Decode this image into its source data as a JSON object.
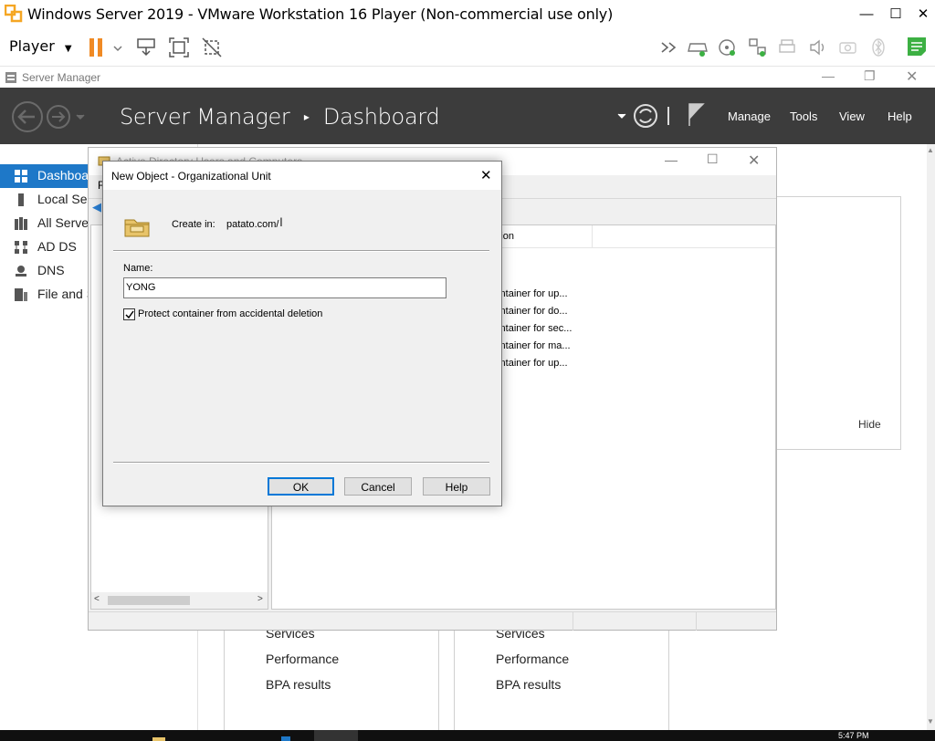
{
  "vmware": {
    "title": "Windows Server 2019 - VMware Workstation 16 Player (Non-commercial use only)",
    "player_menu": "Player",
    "window_controls": [
      "—",
      "☐",
      "✕"
    ]
  },
  "server_manager": {
    "window_title": "Server Manager",
    "breadcrumb_app": "Server Manager",
    "breadcrumb_sep": "▸",
    "breadcrumb_page": "Dashboard",
    "menu": {
      "manage": "Manage",
      "tools": "Tools",
      "view": "View",
      "help": "Help"
    },
    "nav": [
      {
        "label": "Dashboard",
        "icon": "dashboard-icon"
      },
      {
        "label": "Local Server",
        "icon": "server-icon"
      },
      {
        "label": "All Servers",
        "icon": "servers-icon"
      },
      {
        "label": "AD DS",
        "icon": "adds-icon"
      },
      {
        "label": "DNS",
        "icon": "dns-icon"
      },
      {
        "label": "File and Storage Services",
        "icon": "file-storage-icon"
      }
    ],
    "hide_label": "Hide",
    "tiles": [
      {
        "services": "Services",
        "performance": "Performance",
        "bpa": "BPA results"
      },
      {
        "services": "Services",
        "performance": "Performance",
        "bpa": "BPA results"
      }
    ]
  },
  "aduc": {
    "title": "Active Directory Users and Computers",
    "column_header": "Description",
    "rows": [
      "Default container for up...",
      "Default container for do...",
      "Default container for sec...",
      "Default container for ma...",
      "Default container for up..."
    ]
  },
  "dialog": {
    "title": "New Object - Organizational Unit",
    "create_in_label": "Create in:",
    "create_in_value": "patato.com/",
    "name_label": "Name:",
    "name_value": "YONG",
    "protect_label": "Protect container from accidental deletion",
    "protect_checked": true,
    "ok": "OK",
    "cancel": "Cancel",
    "help": "Help"
  },
  "taskbar": {
    "clock": "5:47 PM"
  }
}
